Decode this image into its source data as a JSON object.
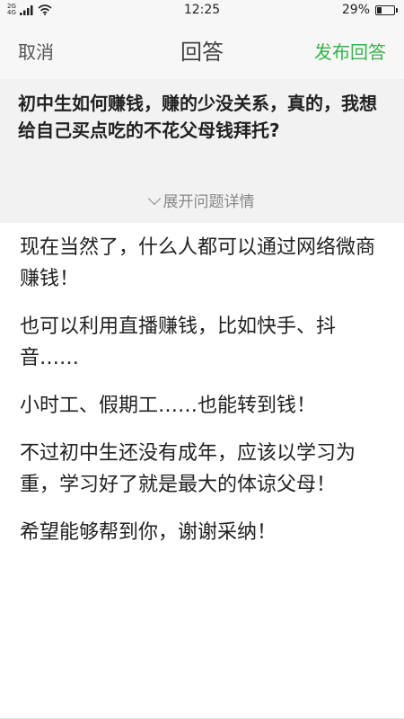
{
  "status_bar": {
    "network_top": "2G",
    "network_bottom": "4G",
    "time": "12:25",
    "battery_percent": "29%",
    "battery_level": 0.29
  },
  "header": {
    "cancel_label": "取消",
    "title": "回答",
    "publish_label": "发布回答",
    "accent_color": "#36b34a"
  },
  "question": {
    "text": "初中生如何赚钱，赚的少没关系，真的，我想给自己买点吃的不花父母钱拜托?",
    "expand_label": "展开问题详情"
  },
  "answer": {
    "paragraphs": [
      "现在当然了，什么人都可以通过网络微商赚钱！",
      "也可以利用直播赚钱，比如快手、抖音……",
      "小时工、假期工……也能转到钱！",
      "不过初中生还没有成年，应该以学习为重，学习好了就是最大的体谅父母！",
      "希望能够帮到你，谢谢采纳！"
    ]
  }
}
